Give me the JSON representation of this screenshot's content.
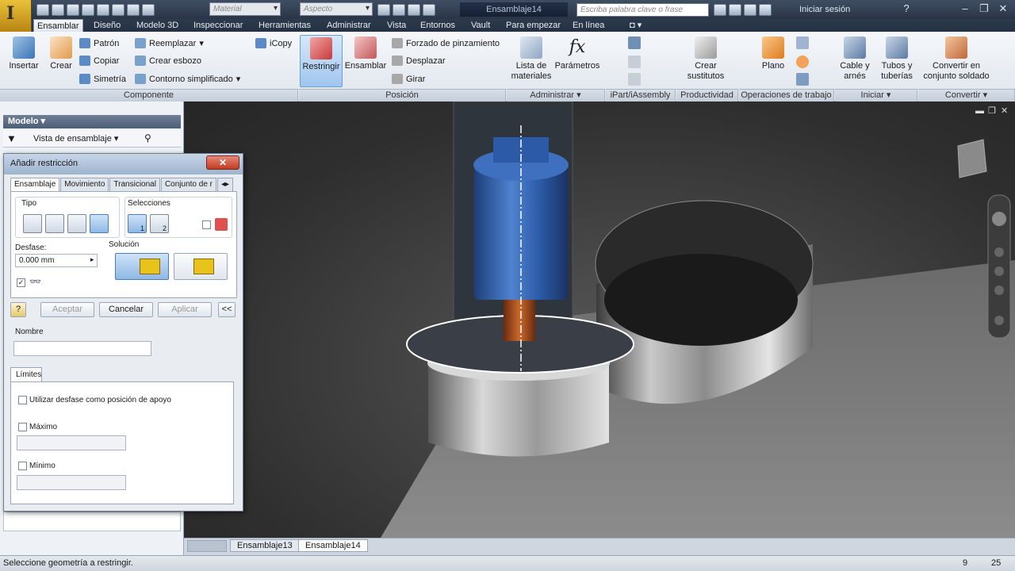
{
  "app": {
    "logo": "I",
    "material_placeholder": "Material",
    "appearance_placeholder": "Aspecto",
    "document_title": "Ensamblaje14",
    "search_placeholder": "Escriba palabra clave o frase",
    "signin": "Iniciar sesión"
  },
  "menu_tabs": [
    "Ensamblar",
    "Diseño",
    "Modelo 3D",
    "Inspeccionar",
    "Herramientas",
    "Administrar",
    "Vista",
    "Entornos",
    "Vault",
    "Para empezar",
    "En línea"
  ],
  "ribbon": {
    "componente": {
      "insertar": "Insertar",
      "crear": "Crear",
      "patron": "Patrón",
      "copiar": "Copiar",
      "simetria": "Simetría",
      "reemplazar": "Reemplazar",
      "crear_esbozo": "Crear esbozo",
      "contorno": "Contorno simplificado",
      "icopy": "iCopy",
      "label": "Componente"
    },
    "posicion": {
      "restringir": "Restringir",
      "ensamblar": "Ensamblar",
      "forzado": "Forzado de pinzamiento",
      "desplazar": "Desplazar",
      "girar": "Girar",
      "label": "Posición"
    },
    "administrar": {
      "lista1": "Lista de",
      "lista2": "materiales",
      "parametros": "Parámetros",
      "label": "Administrar"
    },
    "ipart": {
      "label": "iPart/iAssembly"
    },
    "productividad": {
      "crear1": "Crear",
      "crear2": "sustitutos",
      "label": "Productividad"
    },
    "operaciones": {
      "plano": "Plano",
      "label": "Operaciones de trabajo"
    },
    "iniciar": {
      "cable1": "Cable y",
      "cable2": "arnés",
      "tubos1": "Tubos y",
      "tubos2": "tuberías",
      "label": "Iniciar"
    },
    "convertir": {
      "conv1": "Convertir en",
      "conv2": "conjunto soldado",
      "label": "Convertir"
    }
  },
  "browser": {
    "header": "Modelo",
    "view": "Vista de ensamblaje"
  },
  "dialog": {
    "title": "Añadir restricción",
    "tabs": [
      "Ensamblaje",
      "Movimiento",
      "Transicional",
      "Conjunto de r"
    ],
    "tipo": "Tipo",
    "selecciones": "Selecciones",
    "sel1": "1",
    "sel2": "2",
    "desfase": "Desfase:",
    "desfase_value": "0.000 mm",
    "solucion": "Solución",
    "aceptar": "Aceptar",
    "cancelar": "Cancelar",
    "aplicar": "Aplicar",
    "expand": "<<",
    "nombre": "Nombre",
    "limites": "Límites",
    "usar_desfase": "Utilizar desfase como posición de apoyo",
    "maximo": "Máximo",
    "minimo": "Mínimo"
  },
  "doc_tabs": [
    "Ensamblaje13",
    "Ensamblaje14"
  ],
  "status": {
    "message": "Seleccione geometría a restringir.",
    "count1": "9",
    "count2": "25"
  }
}
